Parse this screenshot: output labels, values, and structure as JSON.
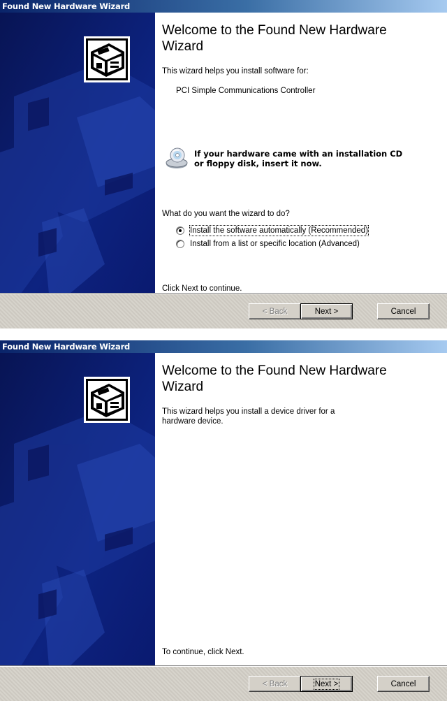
{
  "dialog1": {
    "title": "Found New Hardware Wizard",
    "heading": "Welcome to the Found New Hardware Wizard",
    "intro": "This wizard helps you install software for:",
    "device": "PCI Simple Communications Controller",
    "cd_line1": "If your hardware came with an installation CD",
    "cd_line2": "or floppy disk, insert it now.",
    "question": "What do you want the wizard to do?",
    "options": [
      {
        "label": "Install the software automatically (Recommended)",
        "selected": true
      },
      {
        "label": "Install from a list or specific location (Advanced)",
        "selected": false
      }
    ],
    "footer": "Click Next to continue.",
    "buttons": {
      "back": "< Back",
      "next": "Next >",
      "cancel": "Cancel"
    }
  },
  "dialog2": {
    "title": "Found New Hardware Wizard",
    "heading": "Welcome to the Found New Hardware Wizard",
    "intro_line1": "This wizard helps you install a device driver for a",
    "intro_line2": "hardware device.",
    "footer": "To continue, click Next.",
    "buttons": {
      "back": "< Back",
      "next": "Next >",
      "cancel": "Cancel"
    }
  },
  "colors": {
    "titlebar_start": "#0a246a",
    "titlebar_end": "#a6caf0",
    "side_panel": "#0b1a6e",
    "button_face": "#d4d0c8"
  },
  "icons": [
    "hardware-wizard-icon",
    "cd-drive-icon",
    "radio-icon"
  ]
}
